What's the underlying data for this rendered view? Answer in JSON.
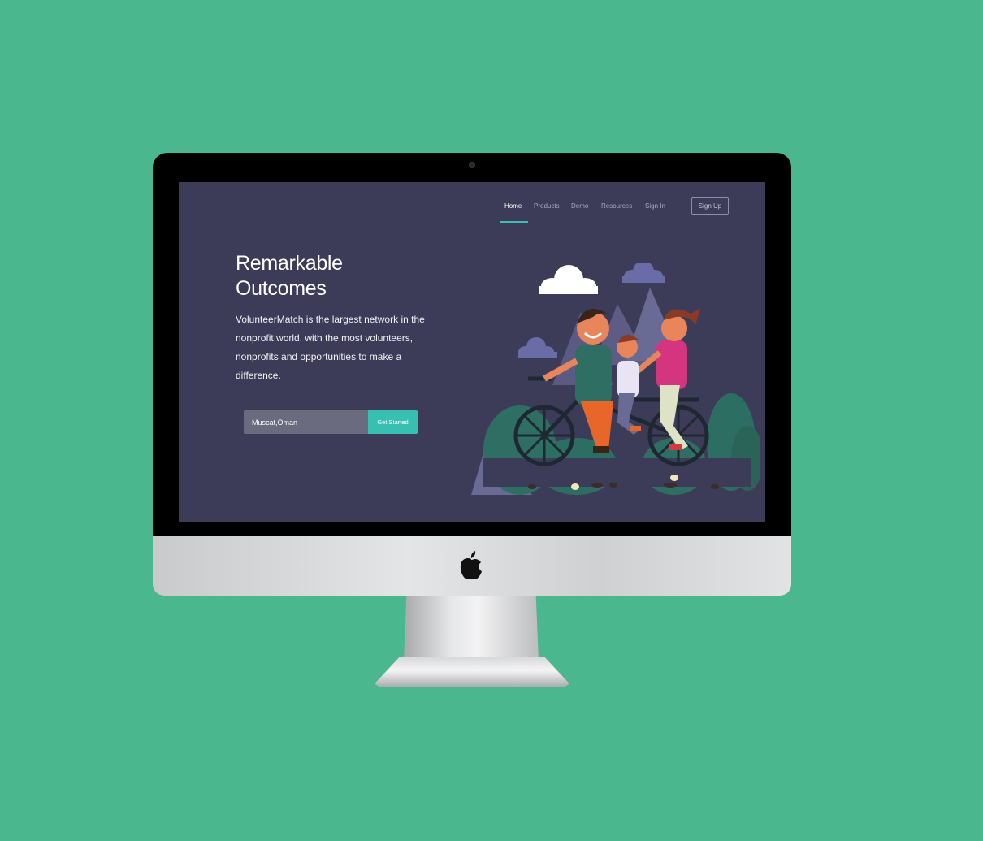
{
  "nav": {
    "items": [
      {
        "label": "Home",
        "active": true
      },
      {
        "label": "Products",
        "active": false
      },
      {
        "label": "Demo",
        "active": false
      },
      {
        "label": "Resources",
        "active": false
      },
      {
        "label": "Sign In",
        "active": false
      }
    ],
    "signup_label": "Sign Up"
  },
  "hero": {
    "title_line1": "Remarkable",
    "title_line2": "Outcomes",
    "body": "VolunteerMatch is the largest network in the nonprofit world, with the most volunteers, nonprofits and opportunities to make a difference."
  },
  "search": {
    "value": "Muscat,Oman",
    "button_label": "Get Started"
  },
  "colors": {
    "background": "#4bb78f",
    "screen_bg": "#3d3c58",
    "accent": "#37c0b2"
  }
}
